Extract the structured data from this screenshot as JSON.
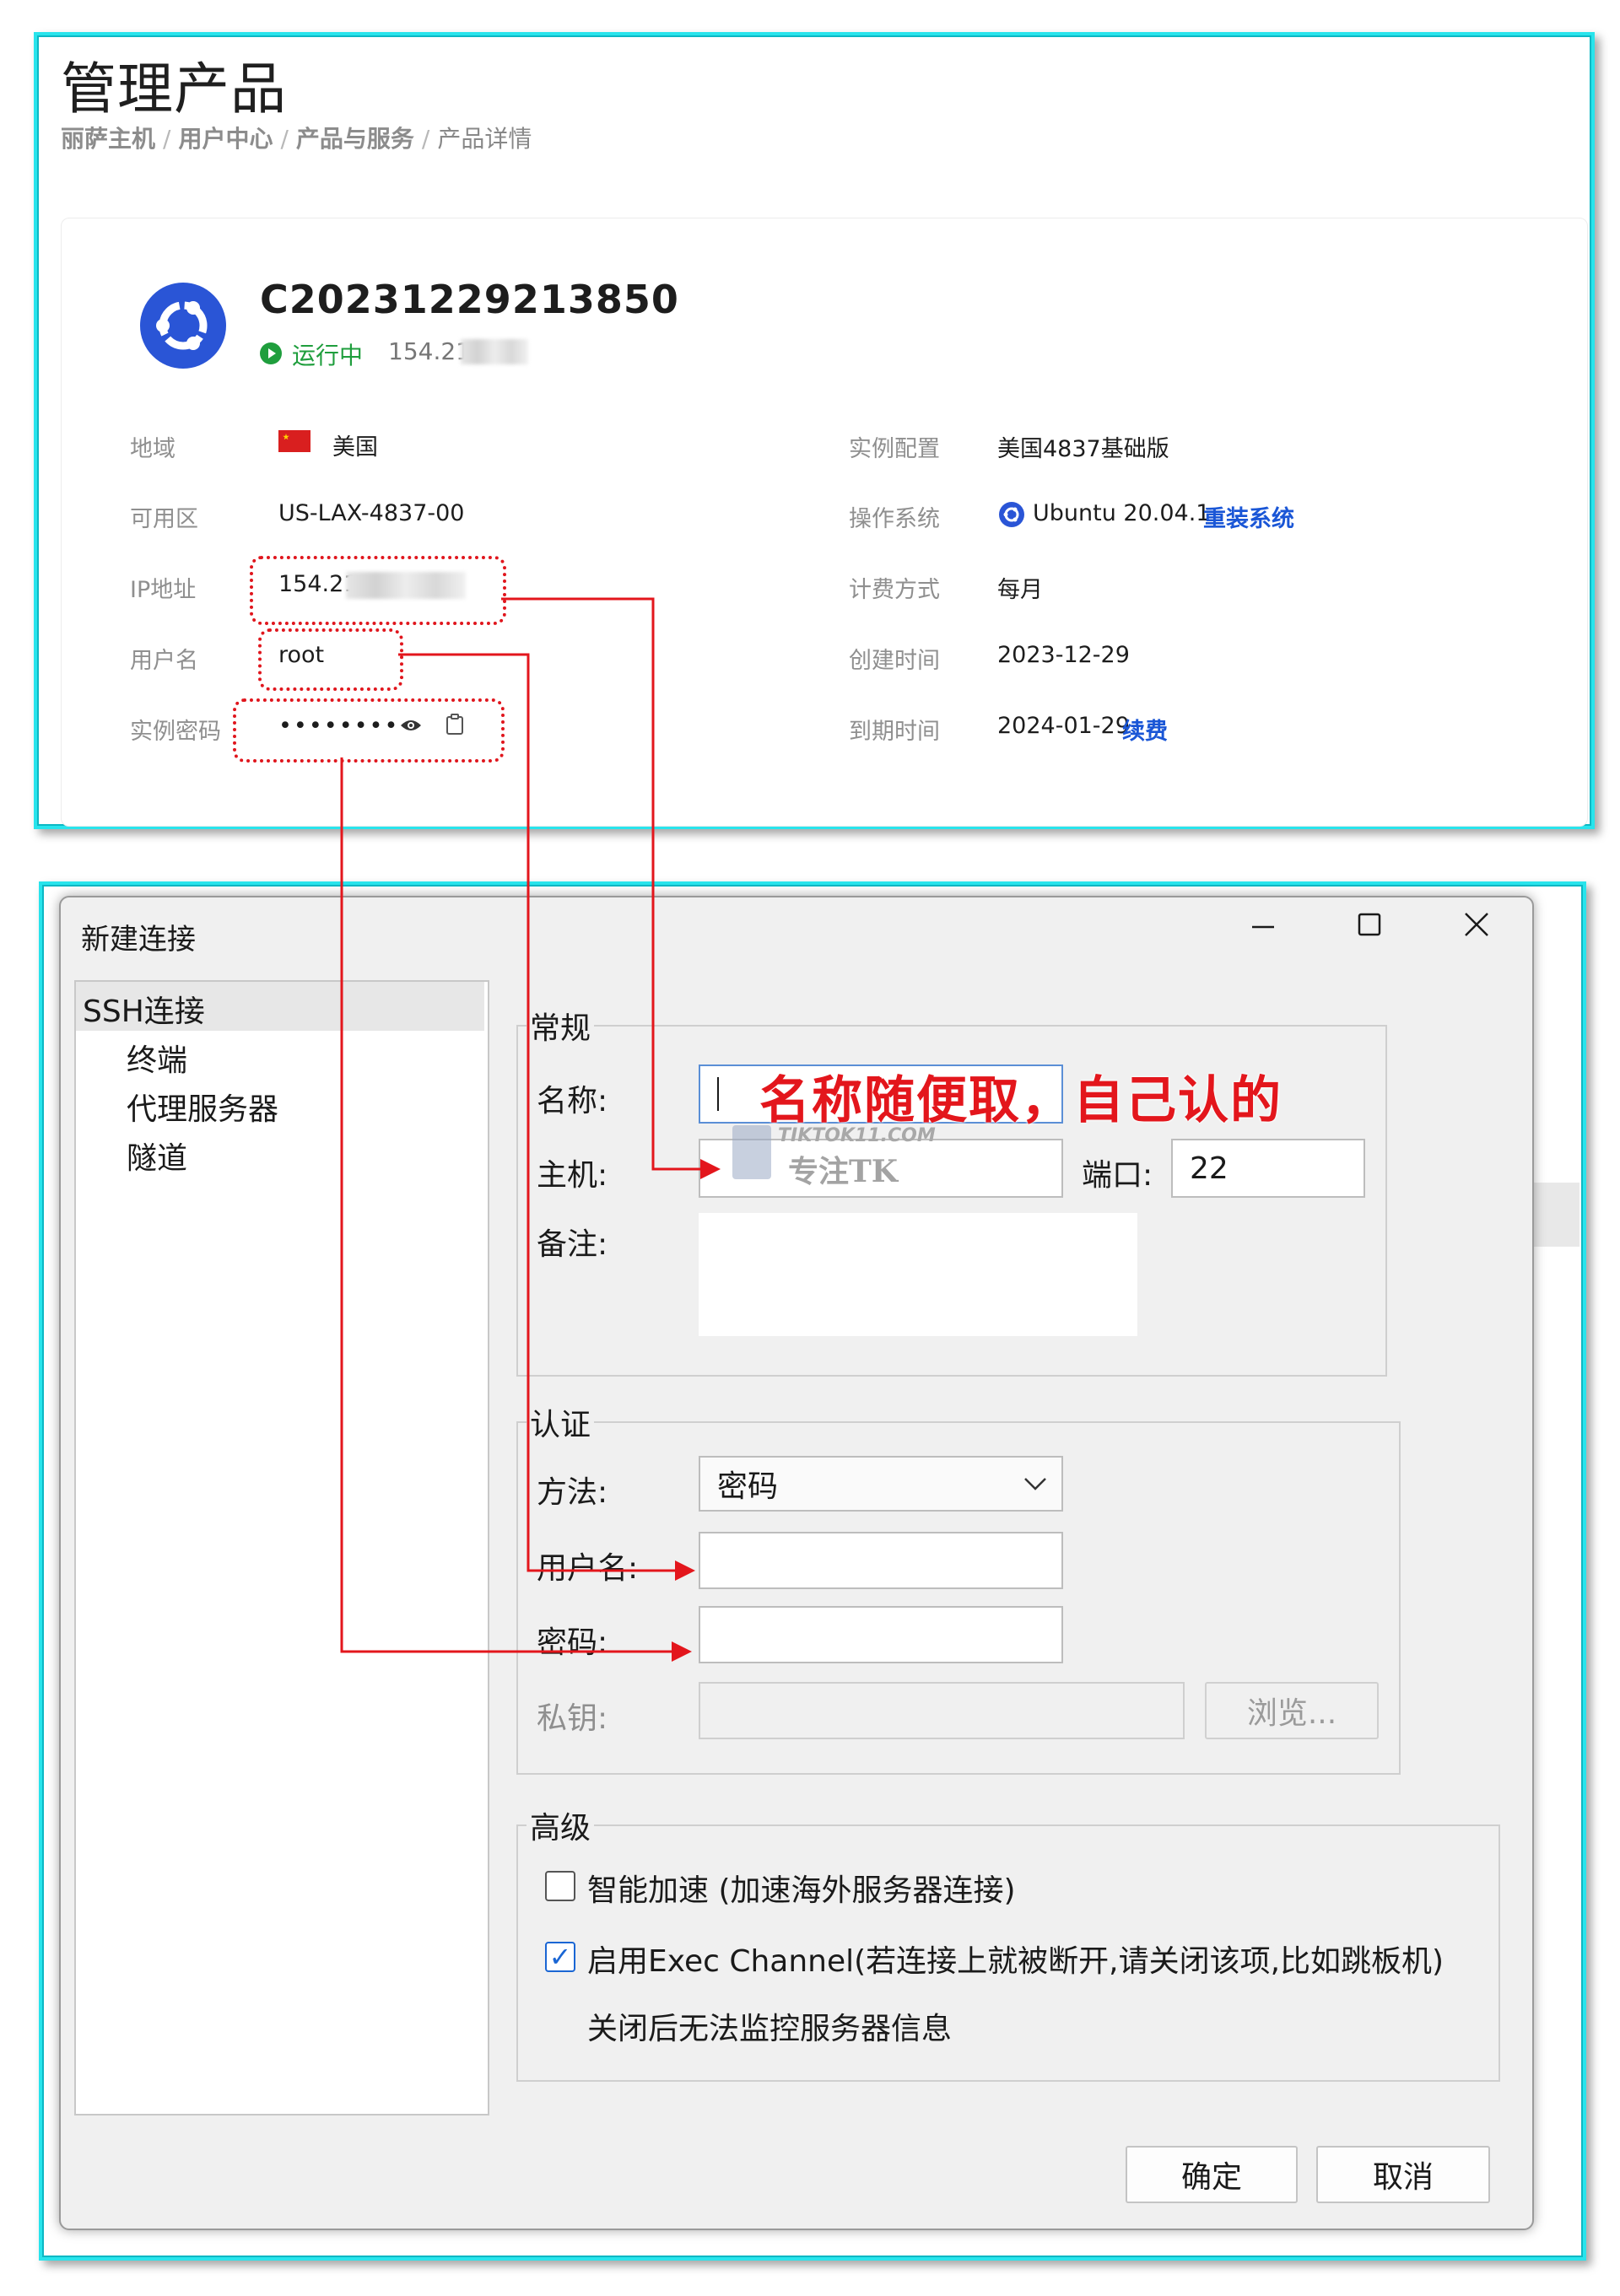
{
  "top": {
    "title": "管理产品",
    "breadcrumb": [
      "丽萨主机",
      "用户中心",
      "产品与服务",
      "产品详情"
    ],
    "instance_id": "C20231229213850",
    "status": "运行中",
    "ip_short": "154.21.",
    "left_labels": [
      "地域",
      "可用区",
      "IP地址",
      "用户名",
      "实例密码"
    ],
    "region": "美国",
    "zone": "US-LAX-4837-00",
    "ip": "154.21",
    "username": "root",
    "password_mask": "••••••••",
    "right_labels": [
      "实例配置",
      "操作系统",
      "计费方式",
      "创建时间",
      "到期时间"
    ],
    "config": "美国4837基础版",
    "os": "Ubuntu 20.04.1",
    "reinstall_link": "重装系统",
    "billing": "每月",
    "created": "2023-12-29",
    "expires": "2024-01-29",
    "renew_link": "续费",
    "status_color": "#1f9e3d",
    "link_color": "#1a56d6"
  },
  "dialog": {
    "title": "新建连接",
    "tree": [
      "SSH连接",
      "终端",
      "代理服务器",
      "隧道"
    ],
    "general_legend": "常规",
    "name_label": "名称:",
    "host_label": "主机:",
    "port_label": "端口:",
    "port_value": "22",
    "note_label": "备注:",
    "auth_legend": "认证",
    "method_label": "方法:",
    "method_value": "密码",
    "user_label": "用户名:",
    "pass_label": "密码:",
    "key_label": "私钥:",
    "browse": "浏览...",
    "advanced_legend": "高级",
    "opt_smart": "智能加速 (加速海外服务器连接)",
    "opt_exec": "启用Exec Channel(若连接上就被断开,请关闭该项,比如跳板机)",
    "opt_exec_note": "关闭后无法监控服务器信息",
    "opt_smart_checked": false,
    "opt_exec_checked": true,
    "ok": "确定",
    "cancel": "取消"
  },
  "annotation": "名称随便取，自己认的",
  "watermark": {
    "url": "TIKTOK11.COM",
    "text": "专注TK"
  },
  "accent_color": "#e3161c"
}
